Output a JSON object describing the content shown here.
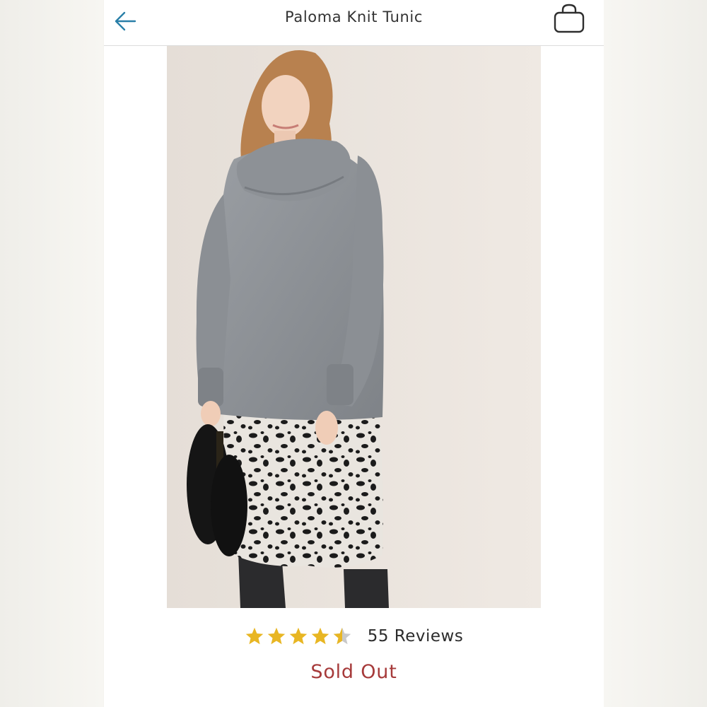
{
  "header": {
    "title": "Paloma Knit Tunic",
    "back_icon": "arrow-left-icon",
    "bag_icon": "shopping-bag-icon"
  },
  "product": {
    "image_alt": "Model wearing grey cowl-neck knit tunic with animal print skirt",
    "rating": 4.5,
    "rating_max": 5,
    "reviews_label": "55 Reviews",
    "status": "Sold Out"
  },
  "colors": {
    "accent": "#2a7fa8",
    "star": "#e8b623",
    "sold_out": "#a63a3a"
  }
}
